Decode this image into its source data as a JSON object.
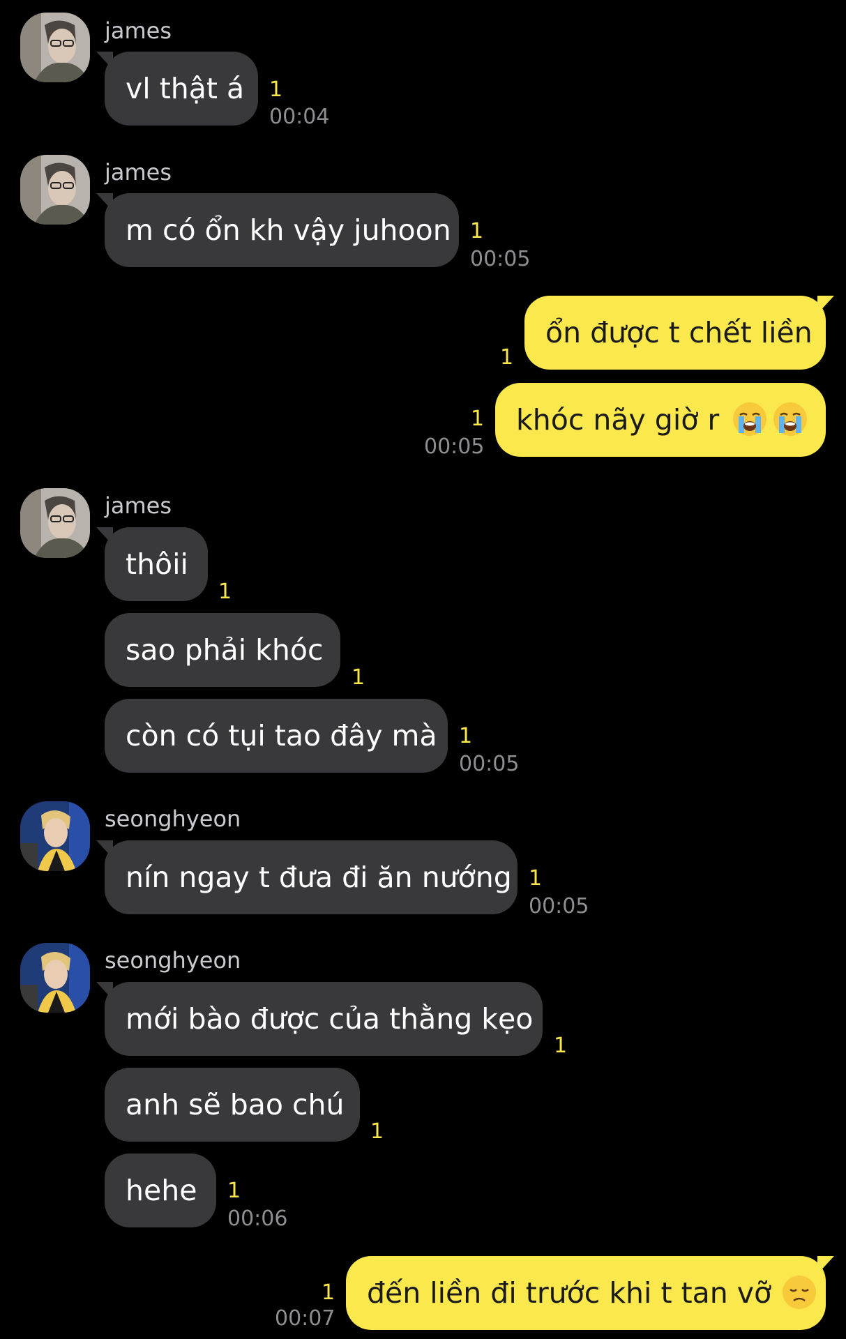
{
  "chat": {
    "groups": [
      {
        "sender": "james",
        "messages": [
          {
            "text": "vl thật á",
            "unread": "1",
            "time": "00:04"
          }
        ]
      },
      {
        "sender": "james",
        "messages": [
          {
            "text": "m có ổn kh vậy juhoon",
            "unread": "1",
            "time": "00:05"
          }
        ]
      },
      {
        "sender": "me",
        "messages": [
          {
            "text": "ổn được t chết liền",
            "unread": "1"
          },
          {
            "text": "khóc nãy giờ r",
            "emoji": [
              "loudly-crying-face-icon",
              "loudly-crying-face-icon"
            ],
            "unread": "1",
            "time": "00:05"
          }
        ]
      },
      {
        "sender": "james",
        "messages": [
          {
            "text": "thôii",
            "unread": "1"
          },
          {
            "text": "sao phải khóc",
            "unread": "1"
          },
          {
            "text": "còn có tụi tao đây mà",
            "unread": "1",
            "time": "00:05"
          }
        ]
      },
      {
        "sender": "seonghyeon",
        "messages": [
          {
            "text": "nín ngay t đưa đi ăn nướng",
            "unread": "1",
            "time": "00:05"
          }
        ]
      },
      {
        "sender": "seonghyeon",
        "messages": [
          {
            "text": "mới bào được của thằng kẹo",
            "unread": "1"
          },
          {
            "text": "anh sẽ bao chú",
            "unread": "1"
          },
          {
            "text": "hehe",
            "unread": "1",
            "time": "00:06"
          }
        ]
      },
      {
        "sender": "me",
        "messages": [
          {
            "text": "đến liền đi trước khi t tan vỡ",
            "emoji": [
              "disappointed-face-icon"
            ],
            "unread": "1",
            "time": "00:07"
          }
        ]
      }
    ]
  },
  "colors": {
    "background": "#000000",
    "incoming_bubble": "#39393c",
    "outgoing_bubble": "#fae84c",
    "unread_count": "#fae84c",
    "timestamp": "#8e8e93"
  }
}
